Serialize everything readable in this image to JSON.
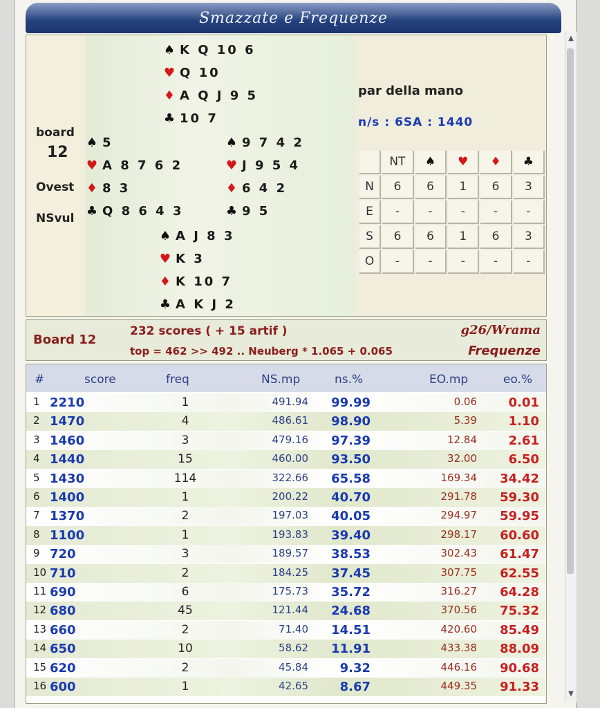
{
  "title": "Smazzate e Frequenze",
  "deal": {
    "board_label": "board",
    "board_number": "12",
    "dealer": "Ovest",
    "vul": "NSvul",
    "north": {
      "spades": "K Q 10 6",
      "hearts": "Q 10",
      "diamonds": "A Q J 9 5",
      "clubs": "10 7"
    },
    "west": {
      "spades": "5",
      "hearts": "A 8 7 6 2",
      "diamonds": "8 3",
      "clubs": "Q 8 6 4 3"
    },
    "east": {
      "spades": "9 7 4 2",
      "hearts": "J 9 5 4",
      "diamonds": "6 4 2",
      "clubs": "9 5"
    },
    "south": {
      "spades": "A J 8 3",
      "hearts": "K 3",
      "diamonds": "K 10 7",
      "clubs": "A K J 2"
    },
    "suit_symbols": {
      "spades": "♠",
      "hearts": "♥",
      "diamonds": "♦",
      "clubs": "♣"
    }
  },
  "par": {
    "title": "par della mano",
    "value": "n/s : 6SA : 1440"
  },
  "tricks_table": {
    "header": [
      "",
      "NT",
      "♠",
      "♥",
      "♦",
      "♣"
    ],
    "rows": [
      [
        "N",
        "6",
        "6",
        "1",
        "6",
        "3"
      ],
      [
        "E",
        "-",
        "-",
        "-",
        "-",
        "-"
      ],
      [
        "S",
        "6",
        "6",
        "1",
        "6",
        "3"
      ],
      [
        "O",
        "-",
        "-",
        "-",
        "-",
        "-"
      ]
    ]
  },
  "summary": {
    "board": "Board 12",
    "scores": "232 scores ( + 15 artif )",
    "top": "top = 462 >> 492 .. Neuberg * 1.065 + 0.065",
    "signature": "g26/Wrama",
    "frequenze": "Frequenze"
  },
  "table": {
    "headers": [
      "#",
      "score",
      "freq",
      "NS.mp",
      "ns.%",
      "EO.mp",
      "eo.%"
    ],
    "rows": [
      [
        "1",
        "2210",
        "1",
        "491.94",
        "99.99",
        "0.06",
        "0.01"
      ],
      [
        "2",
        "1470",
        "4",
        "486.61",
        "98.90",
        "5.39",
        "1.10"
      ],
      [
        "3",
        "1460",
        "3",
        "479.16",
        "97.39",
        "12.84",
        "2.61"
      ],
      [
        "4",
        "1440",
        "15",
        "460.00",
        "93.50",
        "32.00",
        "6.50"
      ],
      [
        "5",
        "1430",
        "114",
        "322.66",
        "65.58",
        "169.34",
        "34.42"
      ],
      [
        "6",
        "1400",
        "1",
        "200.22",
        "40.70",
        "291.78",
        "59.30"
      ],
      [
        "7",
        "1370",
        "2",
        "197.03",
        "40.05",
        "294.97",
        "59.95"
      ],
      [
        "8",
        "1100",
        "1",
        "193.83",
        "39.40",
        "298.17",
        "60.60"
      ],
      [
        "9",
        "720",
        "3",
        "189.57",
        "38.53",
        "302.43",
        "61.47"
      ],
      [
        "10",
        "710",
        "2",
        "184.25",
        "37.45",
        "307.75",
        "62.55"
      ],
      [
        "11",
        "690",
        "6",
        "175.73",
        "35.72",
        "316.27",
        "64.28"
      ],
      [
        "12",
        "680",
        "45",
        "121.44",
        "24.68",
        "370.56",
        "75.32"
      ],
      [
        "13",
        "660",
        "2",
        "71.40",
        "14.51",
        "420.60",
        "85.49"
      ],
      [
        "14",
        "650",
        "10",
        "58.62",
        "11.91",
        "433.38",
        "88.09"
      ],
      [
        "15",
        "620",
        "2",
        "45.84",
        "9.32",
        "446.16",
        "90.68"
      ],
      [
        "16",
        "600",
        "1",
        "42.65",
        "8.67",
        "449.35",
        "91.33"
      ]
    ]
  },
  "colors": {
    "title_bar": "#23417c",
    "red_suit": "#d41818",
    "score_blue": "#1a3ab0",
    "eo_red": "#c61f1f"
  }
}
